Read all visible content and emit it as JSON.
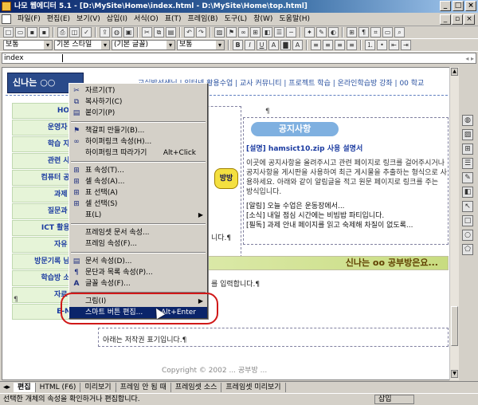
{
  "window": {
    "title": "나모 웹에디터 5.1 - [D:\\MySite\\Home\\index.html - D:\\MySite\\Home\\top.html]"
  },
  "menubar": {
    "items": [
      "파일(F)",
      "편집(E)",
      "보기(V)",
      "삽입(I)",
      "서식(O)",
      "표(T)",
      "프레임(B)",
      "도구(L)",
      "창(W)",
      "도움말(H)"
    ]
  },
  "format_bar": {
    "style": "보통",
    "font": "기본 스타일",
    "font2": "(기본 글꼴)",
    "size": "보통"
  },
  "address": {
    "value": "index"
  },
  "page": {
    "logo": "신나는 ○○",
    "nav": "교실밖선생님 | 인터넷 활용수업 | 교사 커뮤니티 | 프로젝트 학습 | 온라인학습방 강좌 | 00 학교",
    "sidenav": [
      "HOM",
      "운영자 소",
      "학습 자료",
      "관련 사이",
      "컴퓨터 공부",
      "과제 안",
      "질문과 답",
      "ICT 활용수",
      "자유 게",
      "방문기록 남기",
      "학습방 소식",
      "자료 정",
      "E-Ma"
    ],
    "badge": "방방",
    "notice_title": "공지사항",
    "notice_header": "[설명] hamsict10.zip 사용 설명서",
    "notice_body": "이곳에 공지사항을 올려주시고 관련 페이지로 링크를 걸어주시거나 공지사항을 게시판을 사용하여 최근 게시물을 추출하는 형식으로 사용하세요. 아래와 같이 알림글을 적고 원문 페이지로 링크를 주는 방식입니다.",
    "notice_items": [
      "[알림] 오늘 수업은 운동장에서...",
      "[소식] 내일 점심 시간에는 비빔밥 파티입니다.",
      "[필독] 과제 안내 페이지를 읽고 숙제해 차질이 없도록..."
    ],
    "para_mark": "¶",
    "frame_text1": "니다.¶",
    "frame_text2": "를 입력합니다.¶",
    "banner": "신나는 oo 공부방은요...",
    "footer_note": "아래는 저작권 표기입니다.¶",
    "copyright": "Copyright © 2002 ... 공부방 ..."
  },
  "context_menu": {
    "items": [
      {
        "icon": "scissors",
        "label": "자르기(T)",
        "shortcut": ""
      },
      {
        "icon": "copy",
        "label": "복사하기(C)",
        "shortcut": ""
      },
      {
        "icon": "paste",
        "label": "붙이기(P)",
        "shortcut": ""
      },
      {
        "sep": true
      },
      {
        "icon": "bookmark",
        "label": "책갈피 만들기(B)...",
        "shortcut": ""
      },
      {
        "icon": "link",
        "label": "하이퍼링크 속성(H)...",
        "shortcut": ""
      },
      {
        "icon": "",
        "label": "하이퍼링크 따라가기",
        "shortcut": "Alt+Click"
      },
      {
        "sep": true
      },
      {
        "icon": "table",
        "label": "표 속성(T)...",
        "shortcut": ""
      },
      {
        "icon": "table",
        "label": "셀 속성(A)...",
        "shortcut": ""
      },
      {
        "icon": "table",
        "label": "표 선택(A)",
        "shortcut": ""
      },
      {
        "icon": "table",
        "label": "셀 선택(S)",
        "shortcut": ""
      },
      {
        "icon": "",
        "label": "표(L)",
        "shortcut": "",
        "sub": true
      },
      {
        "sep": true
      },
      {
        "icon": "",
        "label": "프레임셋 문서 속성...",
        "shortcut": ""
      },
      {
        "icon": "",
        "label": "프레임 속성(F)...",
        "shortcut": ""
      },
      {
        "sep": true
      },
      {
        "icon": "doc",
        "label": "문서 속성(D)...",
        "shortcut": ""
      },
      {
        "icon": "para",
        "label": "문단과 목록 속성(P)...",
        "shortcut": ""
      },
      {
        "icon": "font",
        "label": "글꼴 속성(F)...",
        "shortcut": ""
      },
      {
        "sep": true
      },
      {
        "icon": "",
        "label": "그림(I)",
        "shortcut": "",
        "sub": true
      },
      {
        "icon": "",
        "label": "스마트 버튼 편집...",
        "shortcut": "Alt+Enter",
        "highlight": true
      }
    ]
  },
  "tabs": [
    "편집",
    "HTML (F6)",
    "미리보기",
    "프레임 안 됨 때",
    "프레임셋 소스",
    "프레임셋 미리보기"
  ],
  "status": {
    "text": "선택한 개체의 속성을 확인하거나 편집합니다.",
    "mode": "삽입"
  }
}
